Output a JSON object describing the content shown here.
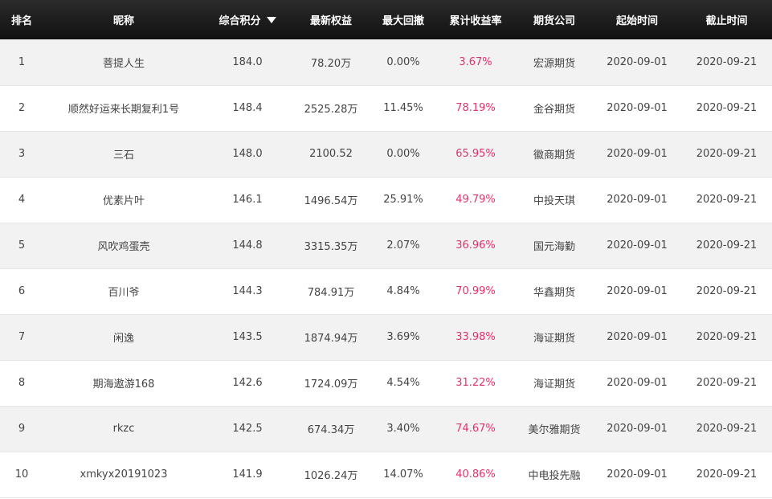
{
  "headers": {
    "rank": "排名",
    "nickname": "昵称",
    "score": "综合积分",
    "equity": "最新权益",
    "drawdown": "最大回撤",
    "return": "累计收益率",
    "company": "期货公司",
    "start": "起始时间",
    "end": "截止时间"
  },
  "colors": {
    "header_bg": "#1a1a1a",
    "return_text": "#e0336c",
    "row_alt": "#f2f2f2"
  },
  "rows": [
    {
      "rank": "1",
      "nickname": "菩提人生",
      "score": "184.0",
      "equity": "78.20万",
      "drawdown": "0.00%",
      "return": "3.67%",
      "company": "宏源期货",
      "start": "2020-09-01",
      "end": "2020-09-21"
    },
    {
      "rank": "2",
      "nickname": "顺然好运来长期复利1号",
      "score": "148.4",
      "equity": "2525.28万",
      "drawdown": "11.45%",
      "return": "78.19%",
      "company": "金谷期货",
      "start": "2020-09-01",
      "end": "2020-09-21"
    },
    {
      "rank": "3",
      "nickname": "三石",
      "score": "148.0",
      "equity": "2100.52",
      "drawdown": "0.00%",
      "return": "65.95%",
      "company": "徽商期货",
      "start": "2020-09-01",
      "end": "2020-09-21"
    },
    {
      "rank": "4",
      "nickname": "优素片叶",
      "score": "146.1",
      "equity": "1496.54万",
      "drawdown": "25.91%",
      "return": "49.79%",
      "company": "中投天琪",
      "start": "2020-09-01",
      "end": "2020-09-21"
    },
    {
      "rank": "5",
      "nickname": "风吹鸡蛋壳",
      "score": "144.8",
      "equity": "3315.35万",
      "drawdown": "2.07%",
      "return": "36.96%",
      "company": "国元海勤",
      "start": "2020-09-01",
      "end": "2020-09-21"
    },
    {
      "rank": "6",
      "nickname": "百川爷",
      "score": "144.3",
      "equity": "784.91万",
      "drawdown": "4.84%",
      "return": "70.99%",
      "company": "华鑫期货",
      "start": "2020-09-01",
      "end": "2020-09-21"
    },
    {
      "rank": "7",
      "nickname": "闲逸",
      "score": "143.5",
      "equity": "1874.94万",
      "drawdown": "3.69%",
      "return": "33.98%",
      "company": "海证期货",
      "start": "2020-09-01",
      "end": "2020-09-21"
    },
    {
      "rank": "8",
      "nickname": "期海遨游168",
      "score": "142.6",
      "equity": "1724.09万",
      "drawdown": "4.54%",
      "return": "31.22%",
      "company": "海证期货",
      "start": "2020-09-01",
      "end": "2020-09-21"
    },
    {
      "rank": "9",
      "nickname": "rkzc",
      "score": "142.5",
      "equity": "674.34万",
      "drawdown": "3.40%",
      "return": "74.67%",
      "company": "美尔雅期货",
      "start": "2020-09-01",
      "end": "2020-09-21"
    },
    {
      "rank": "10",
      "nickname": "xmkyx20191023",
      "score": "141.9",
      "equity": "1026.24万",
      "drawdown": "14.07%",
      "return": "40.86%",
      "company": "中电投先融",
      "start": "2020-09-01",
      "end": "2020-09-21"
    }
  ]
}
